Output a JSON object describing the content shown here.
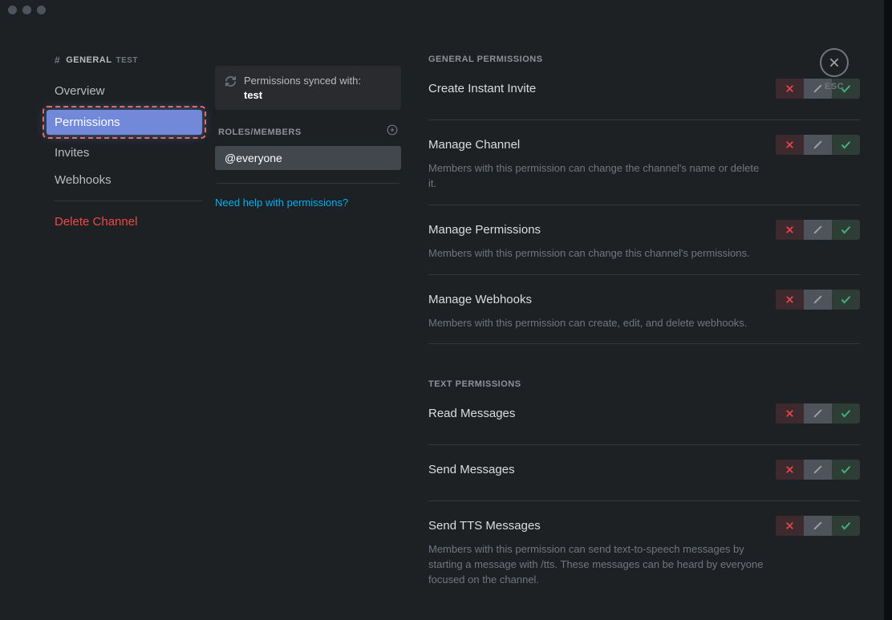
{
  "breadcrumb": {
    "hash": "#",
    "main": "GENERAL",
    "sub": "TEST"
  },
  "nav": {
    "overview": "Overview",
    "permissions": "Permissions",
    "invites": "Invites",
    "webhooks": "Webhooks",
    "delete": "Delete Channel"
  },
  "sync": {
    "line1": "Permissions synced with:",
    "name": "test"
  },
  "roles": {
    "header": "ROLES/MEMBERS",
    "everyone": "@everyone"
  },
  "help_link": "Need help with permissions?",
  "sections": {
    "general": "General Permissions",
    "text": "Text Permissions"
  },
  "perms": {
    "create_invite": {
      "title": "Create Instant Invite",
      "desc": ""
    },
    "manage_channel": {
      "title": "Manage Channel",
      "desc": "Members with this permission can change the channel's name or delete it."
    },
    "manage_permissions": {
      "title": "Manage Permissions",
      "desc": "Members with this permission can change this channel's permissions."
    },
    "manage_webhooks": {
      "title": "Manage Webhooks",
      "desc": "Members with this permission can create, edit, and delete webhooks."
    },
    "read_messages": {
      "title": "Read Messages",
      "desc": ""
    },
    "send_messages": {
      "title": "Send Messages",
      "desc": ""
    },
    "send_tts": {
      "title": "Send TTS Messages",
      "desc": "Members with this permission can send text-to-speech messages by starting a message with /tts. These messages can be heard by everyone focused on the channel."
    }
  },
  "esc": "ESC"
}
